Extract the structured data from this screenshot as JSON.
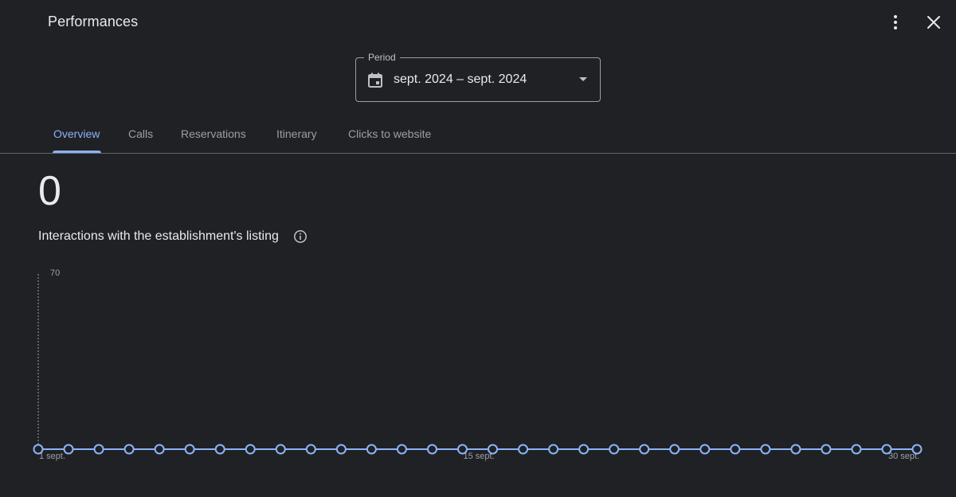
{
  "header": {
    "title": "Performances",
    "more_icon": "more-vert-icon",
    "close_icon": "close-icon"
  },
  "period": {
    "label": "Period",
    "value": "sept. 2024 – sept. 2024",
    "icon": "calendar-icon"
  },
  "tabs": [
    {
      "label": "Overview",
      "active": true
    },
    {
      "label": "Calls",
      "active": false
    },
    {
      "label": "Reservations",
      "active": false
    },
    {
      "label": "Itinerary",
      "active": false
    },
    {
      "label": "Clicks to website",
      "active": false
    }
  ],
  "metric": {
    "value": "0",
    "label": "Interactions with the establishment's listing",
    "info_icon": "info-icon"
  },
  "colors": {
    "background": "#202124",
    "accent": "#8ab4f8",
    "text": "#e8eaed",
    "muted": "#9aa0a6"
  },
  "chart_data": {
    "type": "line",
    "x": [
      "1 sept.",
      "2 sept.",
      "3 sept.",
      "4 sept.",
      "5 sept.",
      "6 sept.",
      "7 sept.",
      "8 sept.",
      "9 sept.",
      "10 sept.",
      "11 sept.",
      "12 sept.",
      "13 sept.",
      "14 sept.",
      "15 sept.",
      "16 sept.",
      "17 sept.",
      "18 sept.",
      "19 sept.",
      "20 sept.",
      "21 sept.",
      "22 sept.",
      "23 sept.",
      "24 sept.",
      "25 sept.",
      "26 sept.",
      "27 sept.",
      "28 sept.",
      "29 sept.",
      "30 sept."
    ],
    "values": [
      0,
      0,
      0,
      0,
      0,
      0,
      0,
      0,
      0,
      0,
      0,
      0,
      0,
      0,
      0,
      0,
      0,
      0,
      0,
      0,
      0,
      0,
      0,
      0,
      0,
      0,
      0,
      0,
      0,
      0
    ],
    "tick_labels": [
      "1 sept.",
      "15 sept.",
      "30 sept."
    ],
    "y_tick": "70",
    "ylim": [
      0,
      70
    ],
    "grid": false,
    "color": "#8ab4f8"
  }
}
